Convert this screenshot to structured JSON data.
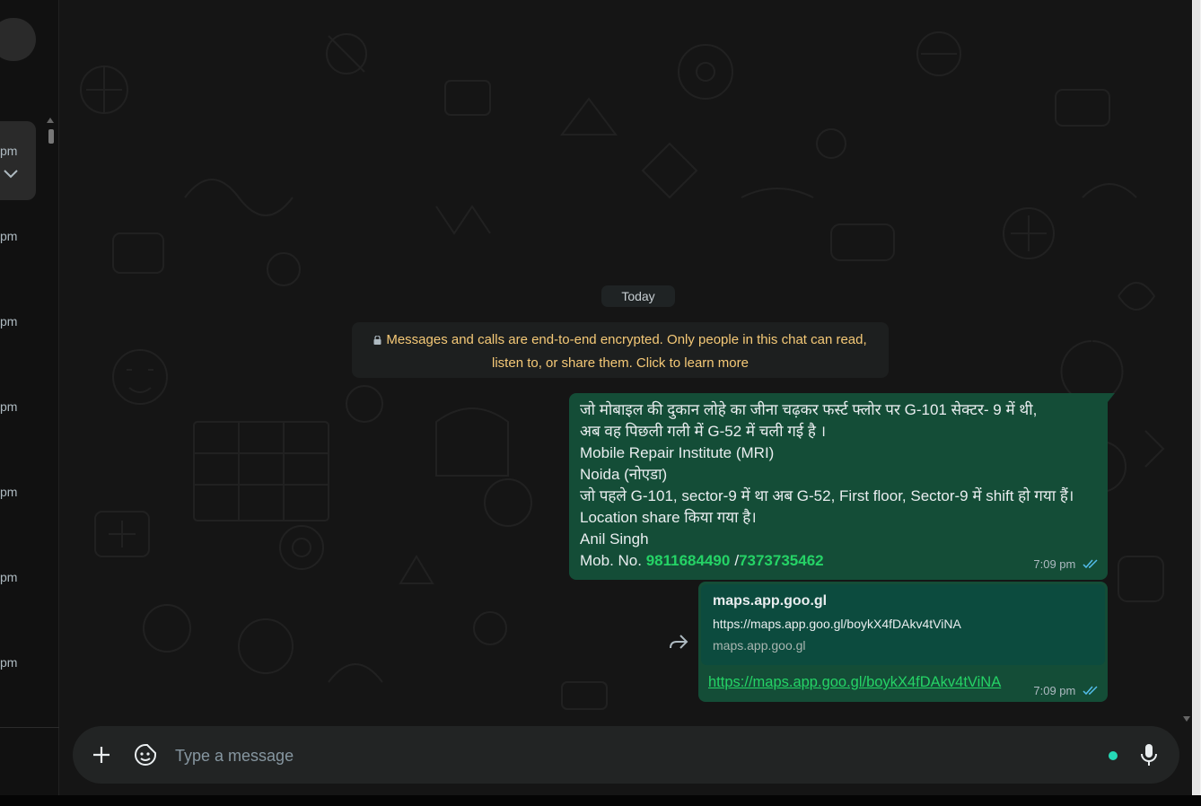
{
  "sidebar": {
    "times": [
      "pm",
      "pm",
      "pm",
      "pm",
      "pm",
      "pm",
      "pm"
    ]
  },
  "chat": {
    "date_chip": "Today",
    "encryption_notice": {
      "line1": "Messages and calls are end-to-end encrypted. Only people in this chat can read,",
      "line2": "listen to, or share them. Click to learn more"
    },
    "messages": [
      {
        "lines": [
          "जो मोबाइल की दुकान लोहे का जीना चढ़कर फर्स्ट फ्लोर पर G-101 सेक्टर- 9 में थी,",
          "अब वह पिछली गली में G-52 में चली गई है ।",
          "Mobile Repair Institute (MRI)",
          "Noida (नोएडा)",
          "जो पहले G-101, sector-9 में था अब G-52, First floor, Sector-9 में shift हो गया हैं।",
          "Location share किया गया है।",
          "Anil Singh"
        ],
        "mob_prefix": "Mob. No.",
        "phone1": "9811684490",
        "separator": "/",
        "phone2": "7373735462",
        "time": "7:09 pm",
        "status": "read"
      },
      {
        "preview_title": "maps.app.goo.gl",
        "preview_url": "https://maps.app.goo.gl/boykX4fDAkv4tViNA",
        "preview_domain": "maps.app.goo.gl",
        "link_text": "https://maps.app.goo.gl/boykX4fDAkv4tViNA",
        "time": "7:09 pm",
        "status": "read"
      }
    ]
  },
  "compose": {
    "placeholder": "Type a message"
  },
  "icons": {
    "attach": "plus-icon",
    "sticker": "sticker-icon",
    "mic": "mic-icon",
    "forward": "forward-icon",
    "read_ticks": "double-check-icon",
    "lock": "lock-icon"
  },
  "colors": {
    "bubble_out": "#144d37",
    "link": "#25d366",
    "notice_text": "#f5c977"
  }
}
